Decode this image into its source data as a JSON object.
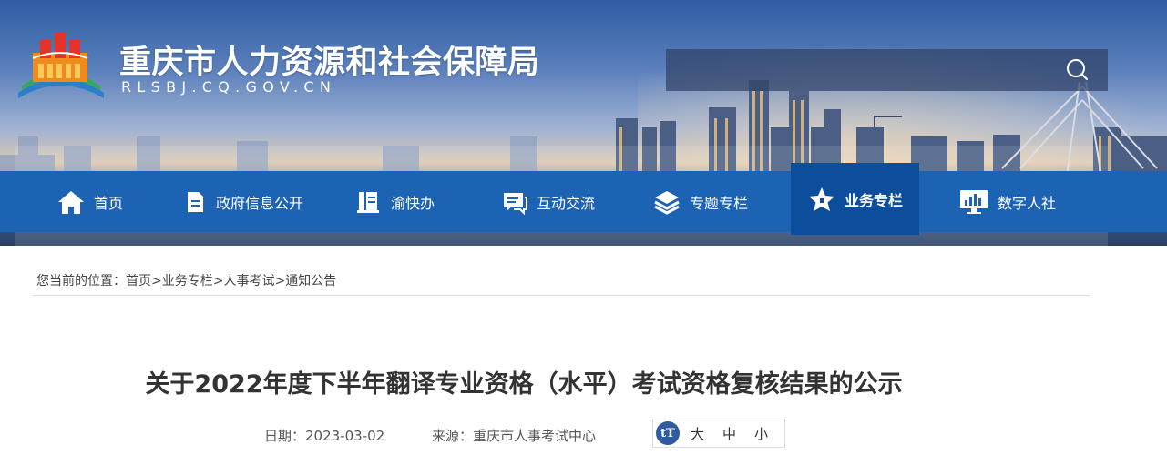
{
  "site": {
    "title": "重庆市人力资源和社会保障局",
    "domain": "RLSBJ.CQ.GOV.CN"
  },
  "search": {
    "value": "",
    "icon": "search-icon"
  },
  "nav": [
    {
      "label": "首页",
      "icon": "home-icon",
      "active": false
    },
    {
      "label": "政府信息公开",
      "icon": "document-icon",
      "active": false
    },
    {
      "label": "渝快办",
      "icon": "book-icon",
      "active": false
    },
    {
      "label": "互动交流",
      "icon": "chat-icon",
      "active": false
    },
    {
      "label": "专题专栏",
      "icon": "layers-icon",
      "active": false
    },
    {
      "label": "业务专栏",
      "icon": "star-icon",
      "active": true
    },
    {
      "label": "数字人社",
      "icon": "monitor-icon",
      "active": false
    }
  ],
  "breadcrumb": {
    "prefix": "您当前的位置：",
    "items": [
      "首页",
      "业务专栏",
      "人事考试",
      "通知公告"
    ],
    "separator": ">"
  },
  "article": {
    "title": "关于2022年度下半年翻译专业资格（水平）考试资格复核结果的公示",
    "date_label": "日期：2023-03-02",
    "source_label": "来源：重庆市人事考试中心"
  },
  "font_size": {
    "icon_text": "tT",
    "options": [
      "大",
      "中",
      "小"
    ]
  },
  "colors": {
    "nav_bg": "#1d63b3",
    "nav_active": "#0d4e9c",
    "title_text": "#333333"
  }
}
